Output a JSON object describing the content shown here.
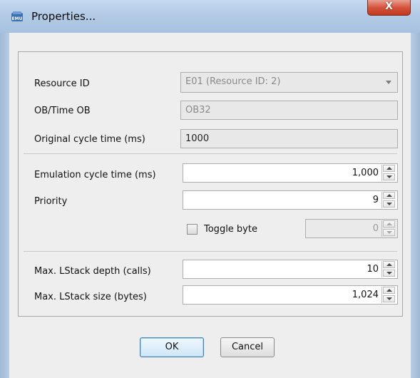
{
  "window": {
    "title": "Properties...",
    "close_label": "X",
    "icon": "emu-app-icon"
  },
  "fields": {
    "resource_id": {
      "label": "Resource ID",
      "value": "E01 (Resource ID: 2)"
    },
    "ob_time_ob": {
      "label": "OB/Time OB",
      "value": "OB32"
    },
    "original_cycle": {
      "label": "Original cycle time (ms)",
      "value": "1000"
    },
    "emulation_cycle": {
      "label": "Emulation cycle time (ms)",
      "value": "1,000"
    },
    "priority": {
      "label": "Priority",
      "value": "9"
    },
    "toggle_byte": {
      "label": "Toggle byte",
      "checked": false,
      "value": "0"
    },
    "lstack_depth": {
      "label": "Max. LStack depth (calls)",
      "value": "10"
    },
    "lstack_size": {
      "label": "Max. LStack size (bytes)",
      "value": "1,024"
    }
  },
  "buttons": {
    "ok": "OK",
    "cancel": "Cancel"
  },
  "colors": {
    "titlebar": "#b3cbe6",
    "close": "#c2371f",
    "default_button_border": "#3c7fb1"
  }
}
